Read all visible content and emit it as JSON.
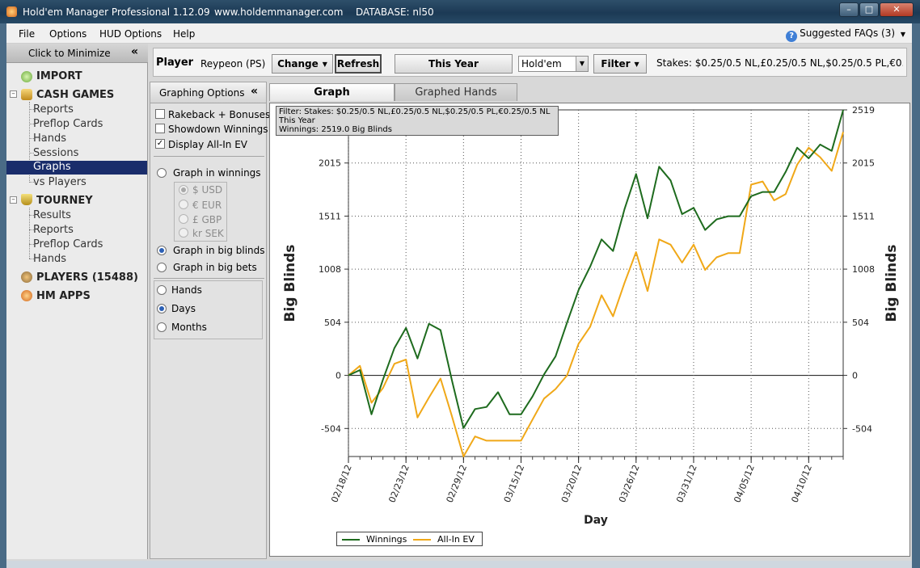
{
  "window": {
    "title": "Hold'em Manager Professional 1.12.09",
    "url": "www.holdemmanager.com",
    "database": "DATABASE: nl50"
  },
  "menu": {
    "items": [
      "File",
      "Options",
      "HUD Options",
      "Help"
    ],
    "faq": "Suggested FAQs (3)"
  },
  "sidebar": {
    "minimize": "Click to Minimize",
    "import": "IMPORT",
    "cash_games": "CASH GAMES",
    "cash_items": [
      "Reports",
      "Preflop Cards",
      "Hands",
      "Sessions",
      "Graphs",
      "vs Players"
    ],
    "tourney": "TOURNEY",
    "tourney_items": [
      "Results",
      "Reports",
      "Preflop Cards",
      "Hands"
    ],
    "players": "PLAYERS (15488)",
    "hm_apps": "HM APPS"
  },
  "toolbar": {
    "player_label": "Player",
    "player_name": "Reypeon (PS)",
    "change": "Change",
    "refresh": "Refresh",
    "date_range": "This Year",
    "game": "Hold'em",
    "filter": "Filter",
    "stakes": "Stakes: $0.25/0.5 NL,£0.25/0.5 NL,$0.25/0.5 PL,€0...."
  },
  "graphing_options": {
    "title": "Graphing Options",
    "checkboxes": [
      {
        "label": "Rakeback + Bonuses",
        "checked": false
      },
      {
        "label": "Showdown Winnings",
        "checked": false
      },
      {
        "label": "Display All-In EV",
        "checked": true
      }
    ],
    "graph_in_winnings": "Graph in winnings",
    "currencies": [
      "$ USD",
      "€ EUR",
      "£ GBP",
      "kr SEK"
    ],
    "graph_in_big_blinds": "Graph in big blinds",
    "graph_in_big_bets": "Graph in big bets",
    "x_modes": [
      "Hands",
      "Days",
      "Months"
    ]
  },
  "tabs": {
    "graph": "Graph",
    "graphed_hands": "Graphed Hands"
  },
  "filter_box": {
    "line1": "Filter: Stakes: $0.25/0.5 NL,£0.25/0.5 NL,$0.25/0.5 PL,€0.25/0.5 NL",
    "line2": "This Year",
    "line3": "Winnings: 2519.0 Big Blinds"
  },
  "chart_data": {
    "type": "line",
    "xlabel": "Day",
    "ylabel": "Big Blinds",
    "ylim": [
      -770,
      2519
    ],
    "y_ticks": [
      -504,
      0,
      504,
      1008,
      1511,
      2015,
      2519
    ],
    "x_tick_labels": [
      "02/18/12",
      "02/23/12",
      "02/29/12",
      "03/15/12",
      "03/20/12",
      "03/26/12",
      "03/31/12",
      "04/05/12",
      "04/10/12"
    ],
    "x_tick_index": [
      0,
      5,
      10,
      15,
      20,
      25,
      30,
      35,
      40
    ],
    "n_points": 44,
    "grid": true,
    "legend": "bottom-left",
    "series": [
      {
        "name": "Winnings",
        "color": "#1e6b1e",
        "values": [
          0,
          50,
          -370,
          -40,
          260,
          450,
          160,
          490,
          430,
          -50,
          -500,
          -320,
          -300,
          -160,
          -370,
          -370,
          -200,
          10,
          180,
          500,
          810,
          1030,
          1290,
          1180,
          1580,
          1910,
          1490,
          1980,
          1850,
          1530,
          1590,
          1380,
          1480,
          1510,
          1510,
          1700,
          1740,
          1740,
          1930,
          2160,
          2060,
          2190,
          2130,
          2519
        ]
      },
      {
        "name": "All-In EV",
        "color": "#f0a818",
        "values": [
          0,
          90,
          -260,
          -120,
          110,
          150,
          -400,
          -210,
          -30,
          -390,
          -770,
          -580,
          -620,
          -620,
          -620,
          -620,
          -420,
          -220,
          -130,
          0,
          300,
          460,
          760,
          560,
          880,
          1170,
          800,
          1290,
          1240,
          1070,
          1240,
          1000,
          1120,
          1160,
          1160,
          1810,
          1840,
          1660,
          1720,
          2000,
          2160,
          2070,
          1940,
          2310
        ]
      }
    ]
  }
}
